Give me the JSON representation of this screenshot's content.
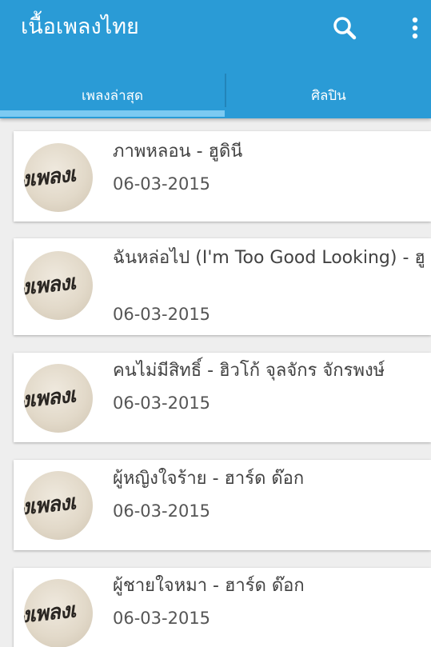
{
  "app": {
    "title": "เนื้อเพลงไทย",
    "accent_color": "#2a9bd6",
    "indicator_color": "#7ccaf2",
    "icons": [
      "search-icon",
      "more-vert-icon"
    ]
  },
  "tabs": [
    {
      "label": "เพลงล่าสุด",
      "selected": true
    },
    {
      "label": "ศิลปิน",
      "selected": false
    }
  ],
  "songs": [
    {
      "title": "ภาพหลอน - ฮูดินี",
      "date": "06-03-2015",
      "thumb_text": "งเพลงเ"
    },
    {
      "title": "ฉันหล่อไป (I'm Too Good Looking) - ฮู",
      "date": "06-03-2015",
      "thumb_text": "งเพลงเ"
    },
    {
      "title": "คนไม่มีสิทธิ์ - ฮิวโก้ จุลจักร จักรพงษ์",
      "date": "06-03-2015",
      "thumb_text": "งเพลงเ"
    },
    {
      "title": "ผู้หญิงใจร้าย - ฮาร์ด ด๊อก",
      "date": "06-03-2015",
      "thumb_text": "งเพลงเ"
    },
    {
      "title": "ผู้ชายใจหมา - ฮาร์ด ด๊อก",
      "date": "06-03-2015",
      "thumb_text": "งเพลงเ"
    }
  ]
}
